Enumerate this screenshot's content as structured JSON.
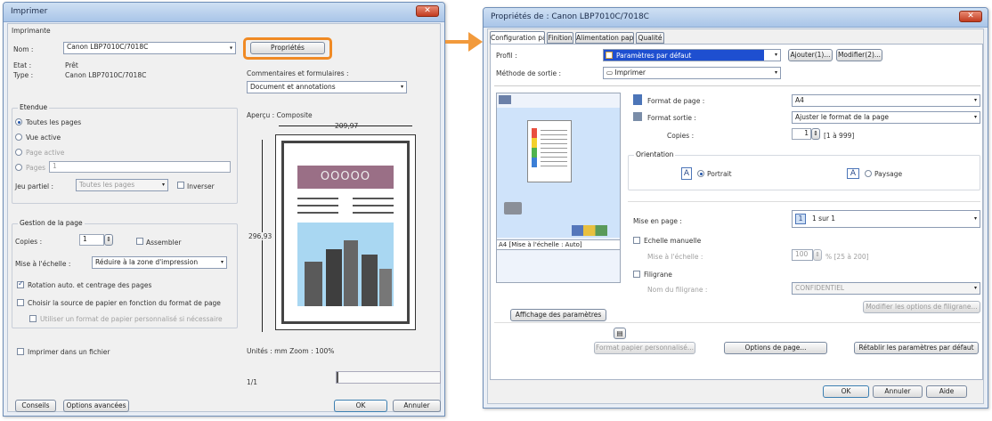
{
  "print_dialog": {
    "title": "Imprimer",
    "close_glyph": "✕",
    "printer_group": "Imprimante",
    "name_label": "Nom :",
    "name_value": "Canon LBP7010C/7018C",
    "status_label": "Etat :",
    "status_value": "Prêt",
    "type_label": "Type :",
    "type_value": "Canon LBP7010C/7018C",
    "properties_button": "Propriétés",
    "comments_label": "Commentaires et formulaires :",
    "comments_value": "Document et annotations",
    "range_group": "Etendue",
    "range_all": "Toutes les pages",
    "range_current": "Vue active",
    "range_active_page": "Page active",
    "range_pages": "Pages",
    "range_pages_value": "1",
    "subset_label": "Jeu partiel :",
    "subset_value": "Toutes les pages",
    "reverse_label": "Inverser",
    "page_handling_group": "Gestion de la page",
    "copies_label": "Copies :",
    "copies_value": "1",
    "collate_label": "Assembler",
    "scaling_label": "Mise à l'échelle :",
    "scaling_value": "Réduire à la zone d'impression",
    "autorotate_label": "Rotation auto. et centrage des pages",
    "choose_source_label": "Choisir la source de papier en fonction du format de page",
    "custom_paper_label": "Utiliser un format de papier personnalisé si nécessaire",
    "print_to_file_label": "Imprimer dans un fichier",
    "preview_label": "Aperçu : Composite",
    "preview_width": "209,97",
    "preview_height": "296,93",
    "units_label": "Unités : mm Zoom : 100%",
    "page_indicator": "1/1",
    "tips_button": "Conseils",
    "advanced_button": "Options avancées",
    "ok_button": "OK",
    "cancel_button": "Annuler",
    "preview_banner_text": "OOOOO"
  },
  "props_dialog": {
    "title": "Propriétés de : Canon LBP7010C/7018C",
    "close_glyph": "✕",
    "tabs": [
      "Configuration page",
      "Finition",
      "Alimentation papier",
      "Qualité"
    ],
    "profile_label": "Profil :",
    "profile_value": "Paramètres par défaut",
    "add_button": "Ajouter(1)...",
    "edit_button": "Modifier(2)...",
    "output_method_label": "Méthode de sortie :",
    "output_method_value": "Imprimer",
    "page_size_label": "Format de page :",
    "page_size_value": "A4",
    "output_size_label": "Format sortie :",
    "output_size_value": "Ajuster le format de la page",
    "copies_label": "Copies :",
    "copies_value": "1",
    "copies_range": "[1 à 999]",
    "orientation_label": "Orientation",
    "portrait_label": "Portrait",
    "landscape_label": "Paysage",
    "layout_label": "Mise en page :",
    "layout_value": "1 sur 1",
    "manual_scaling_label": "Echelle manuelle",
    "scaling_label": "Mise à l'échelle :",
    "scaling_value": "100",
    "scaling_range": "% [25 à 200]",
    "watermark_label": "Filigrane",
    "watermark_name_label": "Nom du filigrane :",
    "watermark_value": "CONFIDENTIEL",
    "watermark_options_button": "Modifier les options de filigrane...",
    "preview_caption": "A4 [Mise à l'échelle : Auto]",
    "show_settings_button": "Affichage des paramètres",
    "custom_paper_button": "Format papier personnalisé...",
    "page_options_button": "Options de page...",
    "restore_defaults_button": "Rétablir les paramètres par défaut",
    "ok_button": "OK",
    "cancel_button": "Annuler",
    "help_button": "Aide",
    "layout_icon_text": "1",
    "orientation_icon_text": "A"
  },
  "colors": {
    "highlight": "#f08a24",
    "arrow": "#f29a3c",
    "title_blue": "#a9c5e8",
    "profile_blue": "#1e4fd0"
  },
  "icons": {
    "dropdown": "▾",
    "spinner": "⇕",
    "radio_on": "●",
    "checkbox": "☐"
  }
}
